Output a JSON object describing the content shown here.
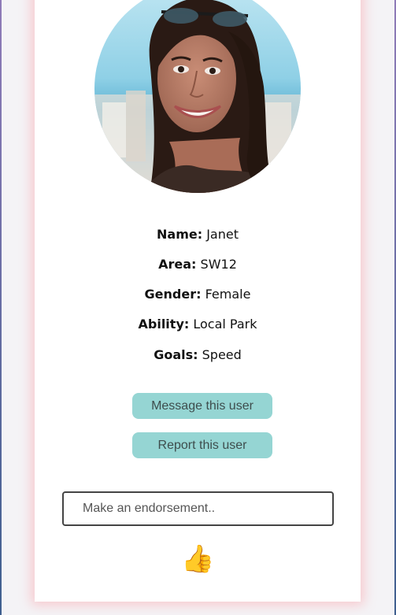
{
  "profile": {
    "avatar_icon": "profile-photo",
    "fields": [
      {
        "label": "Name:",
        "value": "Janet"
      },
      {
        "label": "Area:",
        "value": "SW12"
      },
      {
        "label": "Gender:",
        "value": "Female"
      },
      {
        "label": "Ability:",
        "value": "Local Park"
      },
      {
        "label": "Goals:",
        "value": "Speed"
      }
    ]
  },
  "actions": {
    "message_label": "Message this user",
    "report_label": "Report this user"
  },
  "endorsement": {
    "placeholder": "Make an endorsement..",
    "thumb_icon": "thumbs-up-icon",
    "thumb_glyph": "👍"
  },
  "colors": {
    "button_bg": "#95d5d3",
    "card_shadow": "#ff7882"
  }
}
